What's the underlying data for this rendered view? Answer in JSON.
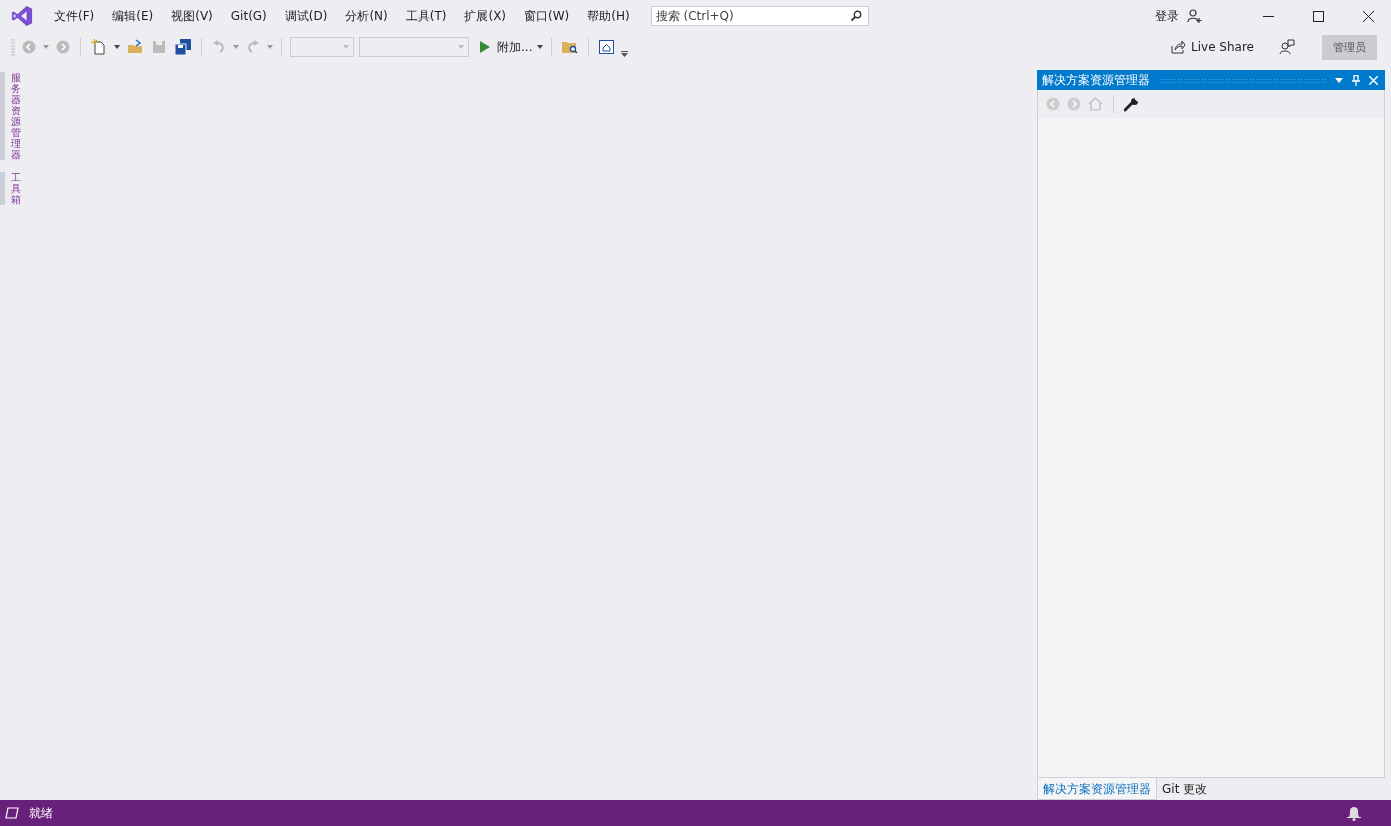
{
  "menu": [
    {
      "label": "文件(F)"
    },
    {
      "label": "编辑(E)"
    },
    {
      "label": "视图(V)"
    },
    {
      "label": "Git(G)"
    },
    {
      "label": "调试(D)"
    },
    {
      "label": "分析(N)"
    },
    {
      "label": "工具(T)"
    },
    {
      "label": "扩展(X)"
    },
    {
      "label": "窗口(W)"
    },
    {
      "label": "帮助(H)"
    }
  ],
  "search": {
    "placeholder": "搜索 (Ctrl+Q)"
  },
  "sign_in": "登录",
  "toolbar": {
    "start_label": "附加..."
  },
  "live_share": "Live Share",
  "admin_badge": "管理员",
  "side_tabs": [
    {
      "label": "服务器资源管理器"
    },
    {
      "label": "工具箱"
    }
  ],
  "solution_explorer": {
    "title": "解决方案资源管理器",
    "tabs": [
      {
        "label": "解决方案资源管理器",
        "selected": true
      },
      {
        "label": "Git 更改",
        "selected": false
      }
    ]
  },
  "status_bar": {
    "text": "就绪"
  }
}
